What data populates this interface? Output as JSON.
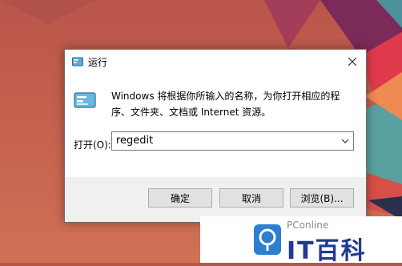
{
  "dialog": {
    "title": "运行",
    "description": "Windows 将根据你所输入的名称，为你打开相应的程序、文件夹、文档或 Internet 资源。",
    "open_label": "打开(O):",
    "input_value": "regedit",
    "buttons": {
      "ok": "确定",
      "cancel": "取消",
      "browse": "浏览(B)..."
    }
  },
  "watermark": {
    "brand": "PConline",
    "name": "IT百科"
  },
  "icons": {
    "title": "run-icon",
    "big": "run-icon",
    "close": "close-icon",
    "dropdown": "chevron-down-icon",
    "watermark": "magnifier-logo-icon"
  },
  "colors": {
    "logo_blue": "#2a7fd1",
    "wm_text": "#1f3a93"
  }
}
